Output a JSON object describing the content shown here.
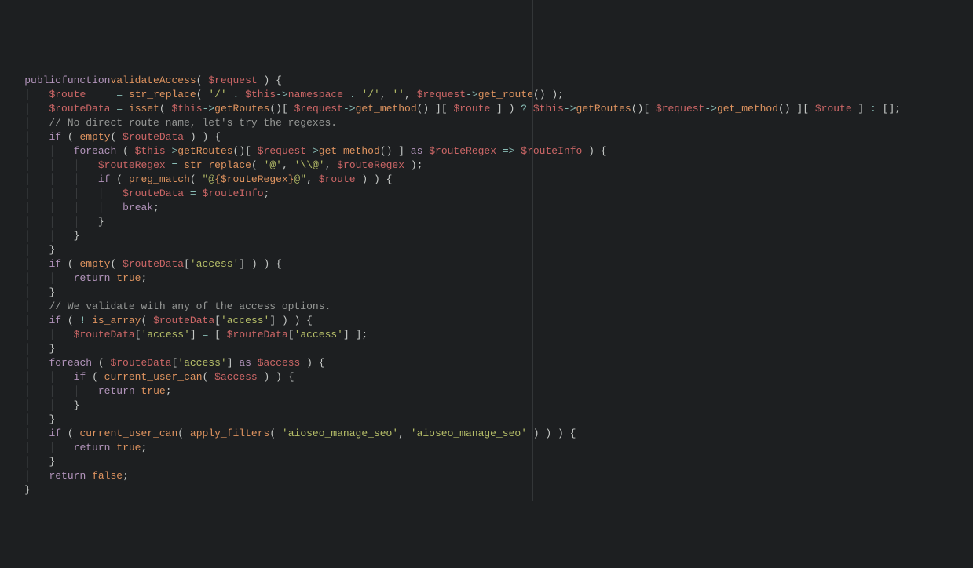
{
  "ruler_column": 80,
  "code": {
    "lines": [
      {
        "indent": 1,
        "tokens": [
          [
            "kw",
            "public"
          ],
          [
            "",
            ""
          ],
          [
            "kw",
            "function"
          ],
          [
            "",
            ""
          ],
          [
            "fn",
            "validateAccess"
          ],
          [
            "punc",
            "( "
          ],
          [
            "var",
            "$request"
          ],
          [
            "punc",
            " ) {"
          ]
        ]
      },
      {
        "indent": 2,
        "tokens": [
          [
            "var",
            "$route"
          ],
          [
            "",
            "     "
          ],
          [
            "op",
            "="
          ],
          [
            "",
            " "
          ],
          [
            "fn",
            "str_replace"
          ],
          [
            "punc",
            "( "
          ],
          [
            "str",
            "'/'"
          ],
          [
            "",
            " "
          ],
          [
            "op",
            "."
          ],
          [
            "",
            " "
          ],
          [
            "var",
            "$this"
          ],
          [
            "op",
            "->"
          ],
          [
            "prop",
            "namespace"
          ],
          [
            "",
            " "
          ],
          [
            "op",
            "."
          ],
          [
            "",
            " "
          ],
          [
            "str",
            "'/'"
          ],
          [
            "punc",
            ", "
          ],
          [
            "str",
            "''"
          ],
          [
            "punc",
            ", "
          ],
          [
            "var",
            "$request"
          ],
          [
            "op",
            "->"
          ],
          [
            "fn",
            "get_route"
          ],
          [
            "punc",
            "() );"
          ]
        ]
      },
      {
        "indent": 2,
        "tokens": [
          [
            "var",
            "$routeData"
          ],
          [
            "",
            " "
          ],
          [
            "op",
            "="
          ],
          [
            "",
            " "
          ],
          [
            "fn",
            "isset"
          ],
          [
            "punc",
            "( "
          ],
          [
            "var",
            "$this"
          ],
          [
            "op",
            "->"
          ],
          [
            "fn",
            "getRoutes"
          ],
          [
            "punc",
            "()[ "
          ],
          [
            "var",
            "$request"
          ],
          [
            "op",
            "->"
          ],
          [
            "fn",
            "get_method"
          ],
          [
            "punc",
            "() ][ "
          ],
          [
            "var",
            "$route"
          ],
          [
            "punc",
            " ] ) "
          ],
          [
            "op",
            "?"
          ],
          [
            "",
            " "
          ],
          [
            "var",
            "$this"
          ],
          [
            "op",
            "->"
          ],
          [
            "fn",
            "getRoutes"
          ],
          [
            "punc",
            "()[ "
          ],
          [
            "var",
            "$request"
          ],
          [
            "op",
            "->"
          ],
          [
            "fn",
            "get_method"
          ],
          [
            "punc",
            "() ][ "
          ],
          [
            "var",
            "$route"
          ],
          [
            "punc",
            " ] "
          ],
          [
            "op",
            ":"
          ],
          [
            "",
            " []"
          ],
          [
            "punc",
            ";"
          ]
        ]
      },
      {
        "indent": 0,
        "tokens": [
          [
            "",
            ""
          ]
        ]
      },
      {
        "indent": 2,
        "tokens": [
          [
            "cmt",
            "// No direct route name, let's try the regexes."
          ]
        ]
      },
      {
        "indent": 2,
        "tokens": [
          [
            "kw",
            "if"
          ],
          [
            "punc",
            " ( "
          ],
          [
            "fn",
            "empty"
          ],
          [
            "punc",
            "( "
          ],
          [
            "var",
            "$routeData"
          ],
          [
            "punc",
            " ) ) {"
          ]
        ]
      },
      {
        "indent": 3,
        "tokens": [
          [
            "kw",
            "foreach"
          ],
          [
            "punc",
            " ( "
          ],
          [
            "var",
            "$this"
          ],
          [
            "op",
            "->"
          ],
          [
            "fn",
            "getRoutes"
          ],
          [
            "punc",
            "()[ "
          ],
          [
            "var",
            "$request"
          ],
          [
            "op",
            "->"
          ],
          [
            "fn",
            "get_method"
          ],
          [
            "punc",
            "() ] "
          ],
          [
            "kw",
            "as"
          ],
          [
            "",
            " "
          ],
          [
            "var",
            "$routeRegex"
          ],
          [
            "",
            " "
          ],
          [
            "op",
            "=>"
          ],
          [
            "",
            " "
          ],
          [
            "var",
            "$routeInfo"
          ],
          [
            "punc",
            " ) {"
          ]
        ]
      },
      {
        "indent": 4,
        "tokens": [
          [
            "var",
            "$routeRegex"
          ],
          [
            "",
            " "
          ],
          [
            "op",
            "="
          ],
          [
            "",
            " "
          ],
          [
            "fn",
            "str_replace"
          ],
          [
            "punc",
            "( "
          ],
          [
            "str",
            "'@'"
          ],
          [
            "punc",
            ", "
          ],
          [
            "str",
            "'\\\\@'"
          ],
          [
            "punc",
            ", "
          ],
          [
            "var",
            "$routeRegex"
          ],
          [
            "punc",
            " );"
          ]
        ]
      },
      {
        "indent": 4,
        "tokens": [
          [
            "kw",
            "if"
          ],
          [
            "punc",
            " ( "
          ],
          [
            "fn",
            "preg_match"
          ],
          [
            "punc",
            "( "
          ],
          [
            "str",
            "\"@"
          ],
          [
            "esc",
            "{$routeRegex}"
          ],
          [
            "str",
            "@\""
          ],
          [
            "punc",
            ", "
          ],
          [
            "var",
            "$route"
          ],
          [
            "punc",
            " ) ) {"
          ]
        ]
      },
      {
        "indent": 5,
        "tokens": [
          [
            "var",
            "$routeData"
          ],
          [
            "",
            " "
          ],
          [
            "op",
            "="
          ],
          [
            "",
            " "
          ],
          [
            "var",
            "$routeInfo"
          ],
          [
            "punc",
            ";"
          ]
        ]
      },
      {
        "indent": 5,
        "tokens": [
          [
            "kw",
            "break"
          ],
          [
            "punc",
            ";"
          ]
        ]
      },
      {
        "indent": 4,
        "tokens": [
          [
            "punc",
            "}"
          ]
        ]
      },
      {
        "indent": 3,
        "tokens": [
          [
            "punc",
            "}"
          ]
        ]
      },
      {
        "indent": 2,
        "tokens": [
          [
            "punc",
            "}"
          ]
        ]
      },
      {
        "indent": 0,
        "tokens": [
          [
            "",
            ""
          ]
        ]
      },
      {
        "indent": 2,
        "tokens": [
          [
            "kw",
            "if"
          ],
          [
            "punc",
            " ( "
          ],
          [
            "fn",
            "empty"
          ],
          [
            "punc",
            "( "
          ],
          [
            "var",
            "$routeData"
          ],
          [
            "punc",
            "["
          ],
          [
            "str",
            "'access'"
          ],
          [
            "punc",
            "] ) ) {"
          ]
        ]
      },
      {
        "indent": 3,
        "tokens": [
          [
            "kw",
            "return"
          ],
          [
            "",
            " "
          ],
          [
            "bool",
            "true"
          ],
          [
            "punc",
            ";"
          ]
        ]
      },
      {
        "indent": 2,
        "tokens": [
          [
            "punc",
            "}"
          ]
        ]
      },
      {
        "indent": 0,
        "tokens": [
          [
            "",
            ""
          ]
        ]
      },
      {
        "indent": 2,
        "tokens": [
          [
            "cmt",
            "// We validate with any of the access options."
          ]
        ]
      },
      {
        "indent": 2,
        "tokens": [
          [
            "kw",
            "if"
          ],
          [
            "punc",
            " ( "
          ],
          [
            "op",
            "!"
          ],
          [
            "",
            " "
          ],
          [
            "fn",
            "is_array"
          ],
          [
            "punc",
            "( "
          ],
          [
            "var",
            "$routeData"
          ],
          [
            "punc",
            "["
          ],
          [
            "str",
            "'access'"
          ],
          [
            "punc",
            "] ) ) {"
          ]
        ]
      },
      {
        "indent": 3,
        "tokens": [
          [
            "var",
            "$routeData"
          ],
          [
            "punc",
            "["
          ],
          [
            "str",
            "'access'"
          ],
          [
            "punc",
            "] "
          ],
          [
            "op",
            "="
          ],
          [
            "",
            " [ "
          ],
          [
            "var",
            "$routeData"
          ],
          [
            "punc",
            "["
          ],
          [
            "str",
            "'access'"
          ],
          [
            "punc",
            "] ];"
          ]
        ]
      },
      {
        "indent": 2,
        "tokens": [
          [
            "punc",
            "}"
          ]
        ]
      },
      {
        "indent": 2,
        "tokens": [
          [
            "kw",
            "foreach"
          ],
          [
            "punc",
            " ( "
          ],
          [
            "var",
            "$routeData"
          ],
          [
            "punc",
            "["
          ],
          [
            "str",
            "'access'"
          ],
          [
            "punc",
            "] "
          ],
          [
            "kw",
            "as"
          ],
          [
            "",
            " "
          ],
          [
            "var",
            "$access"
          ],
          [
            "punc",
            " ) {"
          ]
        ]
      },
      {
        "indent": 3,
        "tokens": [
          [
            "kw",
            "if"
          ],
          [
            "punc",
            " ( "
          ],
          [
            "fn",
            "current_user_can"
          ],
          [
            "punc",
            "( "
          ],
          [
            "var",
            "$access"
          ],
          [
            "punc",
            " ) ) {"
          ]
        ]
      },
      {
        "indent": 4,
        "tokens": [
          [
            "kw",
            "return"
          ],
          [
            "",
            " "
          ],
          [
            "bool",
            "true"
          ],
          [
            "punc",
            ";"
          ]
        ]
      },
      {
        "indent": 3,
        "tokens": [
          [
            "punc",
            "}"
          ]
        ]
      },
      {
        "indent": 2,
        "tokens": [
          [
            "punc",
            "}"
          ]
        ]
      },
      {
        "indent": 0,
        "tokens": [
          [
            "",
            ""
          ]
        ]
      },
      {
        "indent": 2,
        "tokens": [
          [
            "kw",
            "if"
          ],
          [
            "punc",
            " ( "
          ],
          [
            "fn",
            "current_user_can"
          ],
          [
            "punc",
            "( "
          ],
          [
            "fn",
            "apply_filters"
          ],
          [
            "punc",
            "( "
          ],
          [
            "str",
            "'aioseo_manage_seo'"
          ],
          [
            "punc",
            ", "
          ],
          [
            "str",
            "'aioseo_manage_seo'"
          ],
          [
            "punc",
            " ) ) ) {"
          ]
        ]
      },
      {
        "indent": 3,
        "tokens": [
          [
            "kw",
            "return"
          ],
          [
            "",
            " "
          ],
          [
            "bool",
            "true"
          ],
          [
            "punc",
            ";"
          ]
        ]
      },
      {
        "indent": 2,
        "tokens": [
          [
            "punc",
            "}"
          ]
        ]
      },
      {
        "indent": 0,
        "tokens": [
          [
            "",
            ""
          ]
        ]
      },
      {
        "indent": 2,
        "tokens": [
          [
            "kw",
            "return"
          ],
          [
            "",
            " "
          ],
          [
            "bool",
            "false"
          ],
          [
            "punc",
            ";"
          ]
        ]
      },
      {
        "indent": 1,
        "tokens": [
          [
            "punc",
            "}"
          ]
        ]
      }
    ]
  }
}
